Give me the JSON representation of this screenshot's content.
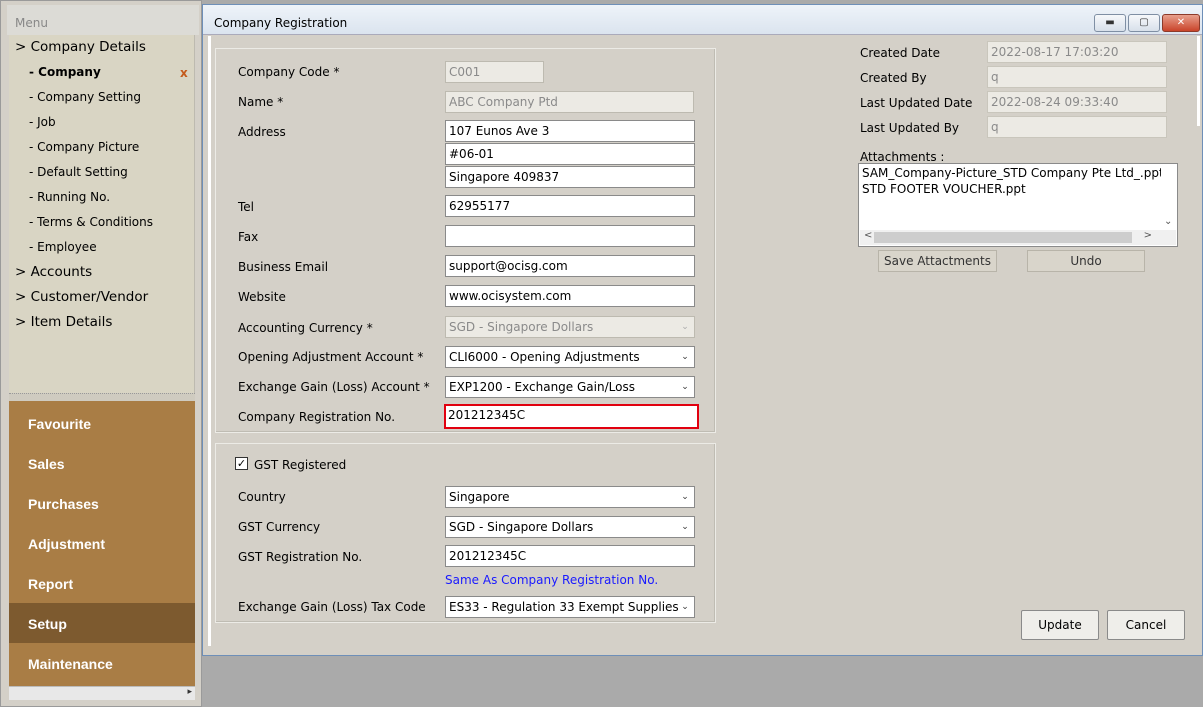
{
  "menu": {
    "title": "Menu",
    "tree": [
      {
        "label": "> Company Details",
        "level": 0
      },
      {
        "label": "- Company",
        "level": 1,
        "active": true
      },
      {
        "label": "- Company Setting",
        "level": 1
      },
      {
        "label": "- Job",
        "level": 1
      },
      {
        "label": "- Company Picture",
        "level": 1
      },
      {
        "label": "- Default Setting",
        "level": 1
      },
      {
        "label": "- Running No.",
        "level": 1
      },
      {
        "label": "- Terms & Conditions",
        "level": 1
      },
      {
        "label": "- Employee",
        "level": 1
      },
      {
        "label": "> Accounts",
        "level": 0
      },
      {
        "label": "> Customer/Vendor",
        "level": 0
      },
      {
        "label": "> Item Details",
        "level": 0
      }
    ],
    "close_mark": "x",
    "bars": [
      "Favourite",
      "Sales",
      "Purchases",
      "Adjustment",
      "Report",
      "Setup",
      "Maintenance"
    ],
    "selected_bar": "Setup",
    "bar_color": "#a97d45",
    "selected_bar_color": "#7d5a2f"
  },
  "window": {
    "title": "Company Registration",
    "min_icon": "minimize-icon",
    "max_icon": "maximize-icon",
    "close_icon": "close-icon"
  },
  "company": {
    "code_label": "Company Code *",
    "code": "C001",
    "name_label": "Name *",
    "name": "ABC Company Ptd",
    "address_label": "Address",
    "address1": "107 Eunos Ave 3",
    "address2": "#06-01",
    "address3": "Singapore 409837",
    "tel_label": "Tel",
    "tel": "62955177",
    "fax_label": "Fax",
    "fax": "",
    "email_label": "Business Email",
    "email": "support@ocisg.com",
    "website_label": "Website",
    "website": "www.ocisystem.com",
    "currency_label": "Accounting Currency *",
    "currency": "SGD - Singapore Dollars",
    "opening_label": "Opening Adjustment Account *",
    "opening": "CLI6000 - Opening Adjustments",
    "exchange_label": "Exchange Gain (Loss) Account *",
    "exchange": "EXP1200 - Exchange Gain/Loss",
    "regno_label": "Company Registration No.",
    "regno": "201212345C"
  },
  "gst": {
    "checkbox_label": "GST Registered",
    "checked": true,
    "country_label": "Country",
    "country": "Singapore",
    "currency_label": "GST Currency",
    "currency": "SGD - Singapore Dollars",
    "regno_label": "GST Registration No.",
    "regno": "201212345C",
    "same_as_link": "Same As Company Registration No.",
    "link_color": "#1a1aff",
    "taxcode_label": "Exchange Gain (Loss) Tax Code",
    "taxcode": "ES33 - Regulation 33 Exempt Supplies"
  },
  "info": {
    "created_date_label": "Created Date",
    "created_date": "2022-08-17 17:03:20",
    "created_by_label": "Created By",
    "created_by": "q",
    "updated_date_label": "Last Updated Date",
    "updated_date": "2022-08-24 09:33:40",
    "updated_by_label": "Last Updated By",
    "updated_by": "q"
  },
  "attachments": {
    "label": "Attachments :",
    "files": [
      "SAM_Company-Picture_STD Company Pte Ltd_.pptx",
      "STD FOOTER VOUCHER.ppt"
    ],
    "save_button": "Save Attactments",
    "undo_button": "Undo"
  },
  "actions": {
    "update": "Update",
    "cancel": "Cancel"
  },
  "highlight_color": "#e1000f"
}
